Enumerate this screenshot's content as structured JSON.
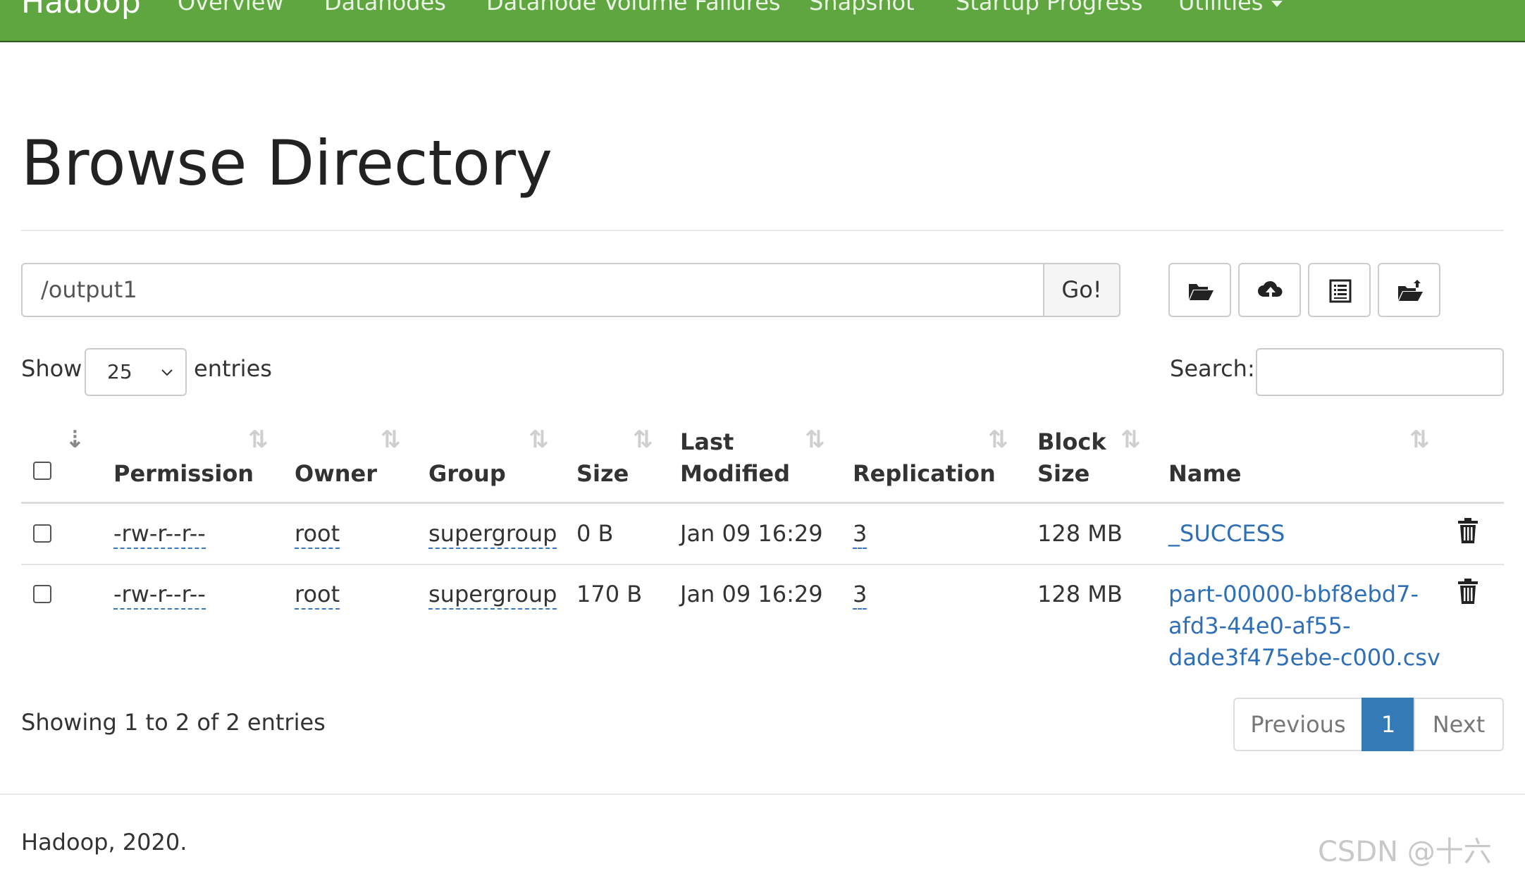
{
  "navbar": {
    "brand": "Hadoop",
    "items": [
      "Overview",
      "Datanodes",
      "Datanode Volume Failures",
      "Snapshot",
      "Startup Progress",
      "Utilities"
    ]
  },
  "page": {
    "title": "Browse Directory"
  },
  "path_bar": {
    "value": "/output1",
    "go_label": "Go!"
  },
  "toolbar_icons": [
    "folder-open-icon",
    "cloud-upload-icon",
    "list-icon",
    "folder-move-icon"
  ],
  "length": {
    "show_label": "Show",
    "selected": "25",
    "entries_label": "entries"
  },
  "search": {
    "label": "Search:",
    "value": ""
  },
  "table": {
    "headers": {
      "permission": "Permission",
      "owner": "Owner",
      "group": "Group",
      "size": "Size",
      "last_modified_1": "Last",
      "last_modified_2": "Modified",
      "replication": "Replication",
      "block_size_1": "Block",
      "block_size_2": "Size",
      "name": "Name"
    },
    "rows": [
      {
        "permission": "-rw-r--r--",
        "owner": "root",
        "group": "supergroup",
        "size": "0 B",
        "last_modified": "Jan 09 16:29",
        "replication": "3",
        "block_size": "128 MB",
        "name_lines": [
          "_SUCCESS"
        ]
      },
      {
        "permission": "-rw-r--r--",
        "owner": "root",
        "group": "supergroup",
        "size": "170 B",
        "last_modified": "Jan 09 16:29",
        "replication": "3",
        "block_size": "128 MB",
        "name_lines": [
          "part-00000-bbf8ebd7-",
          "afd3-44e0-af55-",
          "dade3f475ebe-c000.csv"
        ]
      }
    ]
  },
  "info": "Showing 1 to 2 of 2 entries",
  "pagination": {
    "previous": "Previous",
    "current": "1",
    "next": "Next"
  },
  "footer": "Hadoop, 2020.",
  "watermark": "CSDN @十六",
  "colors": {
    "navbar": "#5fa641",
    "link": "#2f6fb6",
    "active_page": "#337ab7"
  }
}
